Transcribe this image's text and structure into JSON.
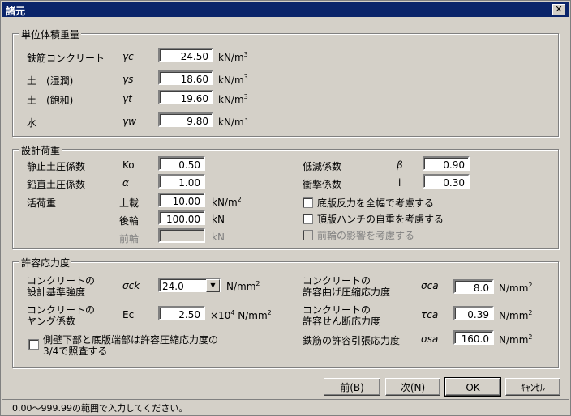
{
  "window": {
    "title": "諸元",
    "close_glyph": "✕"
  },
  "group_unit": {
    "title": "単位体積重量",
    "rows": [
      {
        "label": "鉄筋コンクリート",
        "symbol": "γc",
        "value": "24.50",
        "unit": "kN/m",
        "sup": "3"
      },
      {
        "label": "土　(湿潤)",
        "symbol": "γs",
        "value": "18.60",
        "unit": "kN/m",
        "sup": "3"
      },
      {
        "label": "土　(飽和)",
        "symbol": "γt",
        "value": "19.60",
        "unit": "kN/m",
        "sup": "3"
      },
      {
        "label": "水",
        "symbol": "γw",
        "value": "9.80",
        "unit": "kN/m",
        "sup": "3"
      }
    ]
  },
  "group_load": {
    "title": "設計荷重",
    "static_label": "静止土圧係数",
    "static_sym": "Ko",
    "static_value": "0.50",
    "vertical_label": "鉛直土圧係数",
    "vertical_sym": "α",
    "vertical_value": "1.00",
    "live_label": "活荷重",
    "live_upper_label": "上載",
    "live_upper_value": "10.00",
    "live_upper_unit": "kN/m",
    "live_upper_sup": "2",
    "rear_label": "後輪",
    "rear_value": "100.00",
    "rear_unit": "kN",
    "front_label": "前輪",
    "front_value": "",
    "front_unit": "kN",
    "reduction_label": "低減係数",
    "reduction_sym": "β",
    "reduction_value": "0.90",
    "impact_label": "衝撃係数",
    "impact_sym": "i",
    "impact_value": "0.30",
    "check1": "底版反力を全幅で考慮する",
    "check2": "頂版ハンチの自重を考慮する",
    "check3": "前輪の影響を考慮する"
  },
  "group_allow": {
    "title": "許容応力度",
    "design_label1": "コンクリートの",
    "design_label2": "設計基準強度",
    "design_sym": "σck",
    "design_value": "24.0",
    "design_unit": "N/mm",
    "design_sup": "2",
    "young_label1": "コンクリートの",
    "young_label2": "ヤング係数",
    "young_sym": "Ec",
    "young_value": "2.50",
    "young_mult": "×10",
    "young_exp": "4",
    "young_unit": "N/mm",
    "young_sup": "2",
    "side_check_line1": "側壁下部と底版端部は許容圧縮応力度の",
    "side_check_line2": "3/4で照査する",
    "bend_label1": "コンクリートの",
    "bend_label2": "許容曲げ圧縮応力度",
    "bend_sym": "σca",
    "bend_value": "8.0",
    "bend_unit": "N/mm",
    "bend_sup": "2",
    "shear_label1": "コンクリートの",
    "shear_label2": "許容せん断応力度",
    "shear_sym": "τca",
    "shear_value": "0.39",
    "shear_unit": "N/mm",
    "shear_sup": "2",
    "rebar_label": "鉄筋の許容引張応力度",
    "rebar_sym": "σsa",
    "rebar_value": "160.0",
    "rebar_unit": "N/mm",
    "rebar_sup": "2"
  },
  "buttons": {
    "prev": "前(B)",
    "next": "次(N)",
    "ok": "OK",
    "cancel": "ｷｬﾝｾﾙ"
  },
  "status": "0.00～999.99の範囲で入力してください。"
}
